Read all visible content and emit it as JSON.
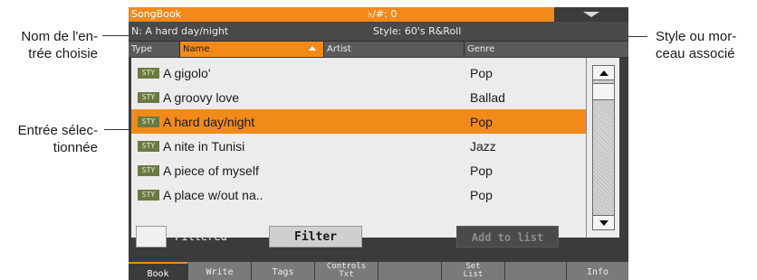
{
  "callouts": {
    "entry_name": [
      "Nom de l'en-",
      "trée choisie"
    ],
    "selected_entry": [
      "Entrée sélec-",
      "tionnée"
    ],
    "style_song": [
      "Style ou mor-",
      "ceau associé"
    ]
  },
  "titlebar": {
    "app": "SongBook",
    "sharp_flat": "♭/#: 0",
    "menu_icon": "triangle-down-icon"
  },
  "infobar": {
    "entry": "N: A hard day/night",
    "style": "Style: 60's R&Roll"
  },
  "columns": {
    "type": "Type",
    "name": "Name",
    "artist": "Artist",
    "genre": "Genre",
    "sorted": "name",
    "sort_direction": "ascending"
  },
  "rows": [
    {
      "type": "STY",
      "name": "A gigolo'",
      "genre": "Pop",
      "selected": false
    },
    {
      "type": "STY",
      "name": "A groovy love",
      "genre": "Ballad",
      "selected": false
    },
    {
      "type": "STY",
      "name": "A hard day/night",
      "genre": "Pop",
      "selected": true
    },
    {
      "type": "STY",
      "name": "A nite in Tunisi",
      "genre": "Jazz",
      "selected": false
    },
    {
      "type": "STY",
      "name": "A piece of myself",
      "genre": "Pop",
      "selected": false
    },
    {
      "type": "STY",
      "name": "A place w/out na..",
      "genre": "Pop",
      "selected": false
    }
  ],
  "controls": {
    "filtered_label": "Filtered",
    "filtered_checked": false,
    "filter_button": "Filter",
    "add_button": "Add to list",
    "add_enabled": false
  },
  "tabs": [
    {
      "label": "Book",
      "active": true
    },
    {
      "label": "Write",
      "active": false
    },
    {
      "label": "Tags",
      "active": false
    },
    {
      "label": "Controls",
      "label2": "Txt",
      "active": false
    },
    {
      "label": "",
      "active": false
    },
    {
      "label": "Set",
      "label2": "List",
      "active": false
    },
    {
      "label": "",
      "active": false
    },
    {
      "label": "Info",
      "active": false
    }
  ],
  "colors": {
    "accent": "#f28a1a",
    "panel": "#3b3b3b",
    "list_bg": "#ececec",
    "badge": "#6b7a44"
  }
}
